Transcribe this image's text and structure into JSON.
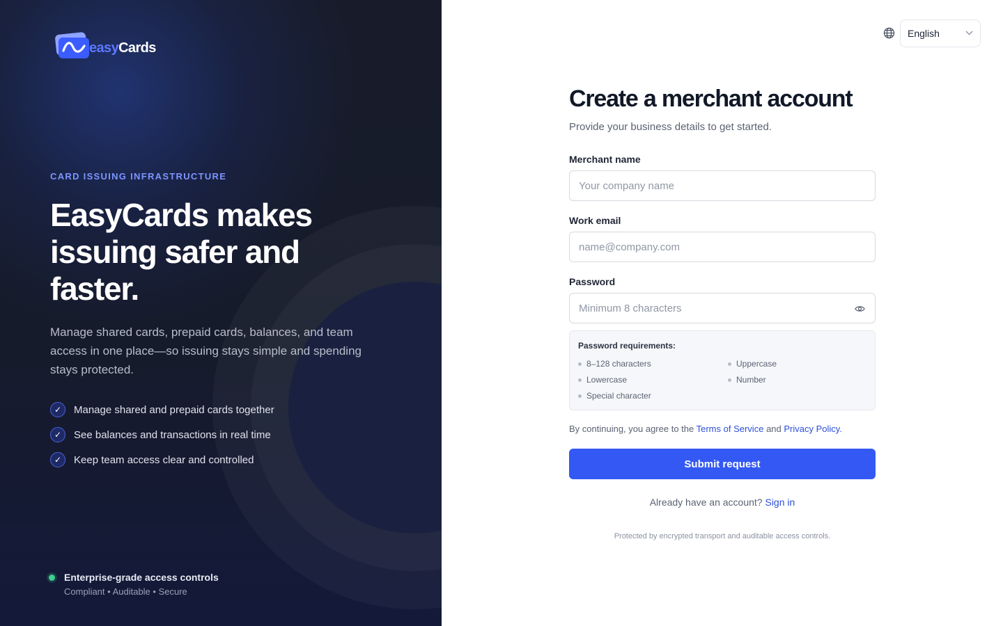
{
  "colors": {
    "accent": "#3358f4",
    "link": "#2c4fd8",
    "status_ok": "#3ecf8e",
    "left_bg": "#161b2b"
  },
  "brand": {
    "logo_part1": "easy",
    "logo_part2": "Cards"
  },
  "hero": {
    "eyebrow": "CARD ISSUING INFRASTRUCTURE",
    "headline": "EasyCards makes issuing safer and faster.",
    "description": "Manage shared cards, prepaid cards, balances, and team access in one place—so issuing stays simple and spending stays protected.",
    "bullets": [
      "Manage shared and prepaid cards together",
      "See balances and transactions in real time",
      "Keep team access clear and controlled"
    ],
    "check_glyph": "✓"
  },
  "status": {
    "title": "Enterprise-grade access controls",
    "subtitle": "Compliant • Auditable • Secure"
  },
  "language": {
    "icon": "globe-icon",
    "selected": "English"
  },
  "form": {
    "title": "Create a merchant account",
    "subtitle": "Provide your business details to get started.",
    "merchant_name": {
      "label": "Merchant name",
      "placeholder": "Your company name",
      "value": ""
    },
    "email": {
      "label": "Work email",
      "placeholder": "name@company.com",
      "value": ""
    },
    "password": {
      "label": "Password",
      "placeholder": "Minimum 8 characters",
      "value": "",
      "toggle_icon": "eye-icon"
    },
    "requirements": {
      "title": "Password requirements:",
      "items": [
        "8–128 characters",
        "Uppercase",
        "Lowercase",
        "Number",
        "Special character"
      ]
    },
    "terms": {
      "prefix": "By continuing, you agree to the",
      "tos": "Terms of Service",
      "and": "and",
      "privacy": "Privacy Policy."
    },
    "submit": "Submit request",
    "signin": {
      "prompt": "Already have an account?",
      "link": "Sign in"
    },
    "footnote": "Protected by encrypted transport and auditable access controls."
  }
}
